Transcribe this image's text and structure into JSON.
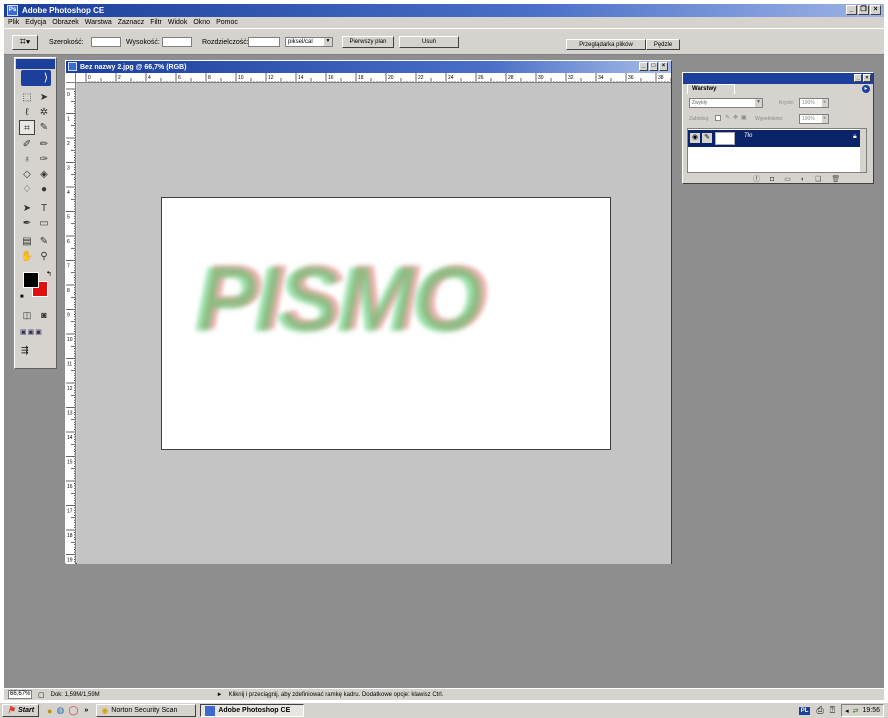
{
  "app": {
    "title": "Adobe Photoshop CE"
  },
  "menu": [
    "Plik",
    "Edycja",
    "Obrazek",
    "Warstwa",
    "Zaznacz",
    "Filtr",
    "Widok",
    "Okno",
    "Pomoc"
  ],
  "options": {
    "width_label": "Szerokość:",
    "height_label": "Wysokość:",
    "resolution_label": "Rozdzielczość:",
    "unit": "piksel/cal",
    "front_image": "Pierwszy plan",
    "clear": "Usuń",
    "palette_tabs": [
      "Przeglądarka plików",
      "Pędzle"
    ]
  },
  "document": {
    "title": "Bez nazwy 2.jpg @ 66,7% (RGB)",
    "canvas_text": "PISMO",
    "ruler_top": [
      "0",
      "2",
      "4",
      "6",
      "8",
      "10",
      "12",
      "14",
      "16",
      "18",
      "20",
      "22",
      "24",
      "26",
      "28",
      "30",
      "32",
      "34",
      "36",
      "38"
    ],
    "ruler_left": [
      "0",
      "1",
      "2",
      "3",
      "4",
      "5",
      "6",
      "7",
      "8",
      "9",
      "10",
      "11",
      "12",
      "13",
      "14",
      "15",
      "16",
      "17",
      "18",
      "19"
    ]
  },
  "layers": {
    "tab": "Warstwy",
    "blend_mode": "Zwykły",
    "opacity_label": "Krycie:",
    "opacity": "100%",
    "lock_label": "Zablokuj:",
    "fill_label": "Wypełnienie:",
    "fill": "100%",
    "layer_name": "Tło"
  },
  "status": {
    "zoom": "66,67%",
    "doc_info": "Dok: 1,59M/1,59M",
    "hint": "Kliknij i przeciągnij, aby zdefiniować ramkę kadru. Dodatkowe opcje: klawisz Ctrl."
  },
  "taskbar": {
    "start": "Start",
    "chevron": "»",
    "tasks": [
      "Norton Security Scan",
      "Adobe Photoshop CE"
    ],
    "lang": "PL",
    "time": "19:56"
  },
  "colors": {
    "title_blue": "#1b3f9a",
    "foreground": "#000000",
    "background_color": "#e01010",
    "workspace": "#8e8e8e"
  }
}
